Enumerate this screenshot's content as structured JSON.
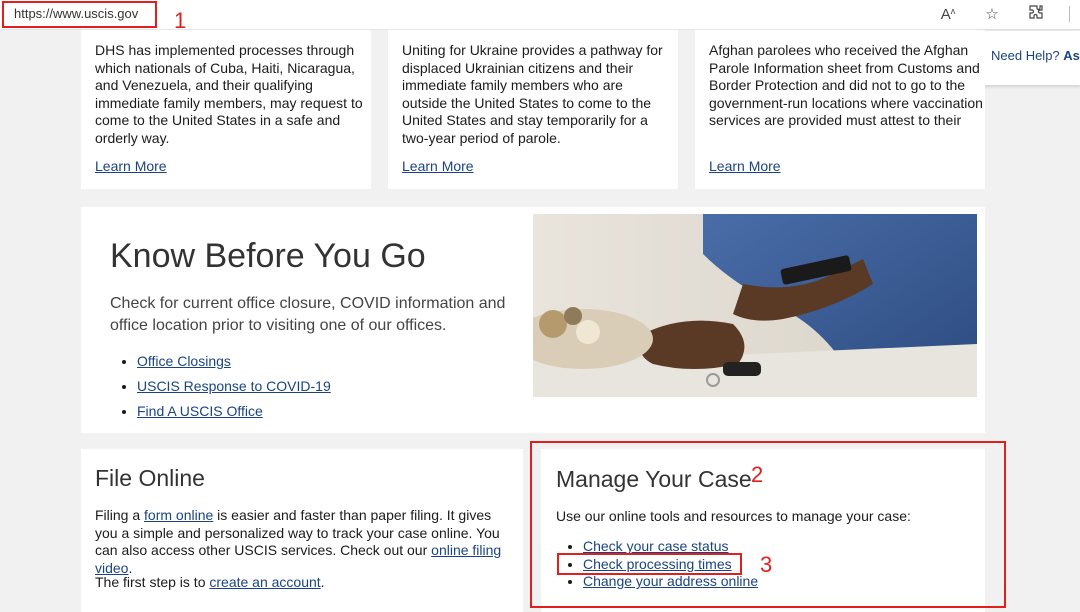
{
  "browser": {
    "url": "https://www.uscis.gov",
    "icons": [
      "read-aloud-icon",
      "add-favorite-icon",
      "extensions-icon"
    ]
  },
  "annotations": [
    "1",
    "2",
    "3"
  ],
  "need_help": {
    "text": "Need Help?",
    "ask": "Ask"
  },
  "cards": [
    {
      "text": "DHS has implemented processes through which nationals of Cuba, Haiti, Nicaragua, and Venezuela, and their qualifying immediate family members, may request to come to the United States in a safe and orderly way.",
      "link": "Learn More"
    },
    {
      "text": "Uniting for Ukraine provides a pathway for displaced Ukrainian citizens and their immediate family members who are outside the United States to come to the United States and stay temporarily for a two-year period of parole.",
      "link": "Learn More"
    },
    {
      "text": "Afghan parolees who received the Afghan Parole Information sheet from Customs and Border Protection and did not to go to the government-run locations where vaccination services are provided must attest to their",
      "link": "Learn More"
    }
  ],
  "know_before": {
    "title": "Know Before You Go",
    "desc": "Check for current office closure, COVID information and office location prior to visiting one of our offices.",
    "links": [
      "Office Closings",
      "USCIS Response to COVID-19",
      "Find A USCIS Office"
    ]
  },
  "file_online": {
    "title": "File Online",
    "p1_a": "Filing a ",
    "p1_link": "form online",
    "p1_b": " is easier and faster than paper filing. It gives you a simple and personalized way to track your case online. You can also access other USCIS services. Check out our ",
    "p1_link2": "online filing video",
    "p1_c": ".",
    "p2_a": "The first step is to ",
    "p2_link": "create an account",
    "p2_b": "."
  },
  "manage_case": {
    "title": "Manage Your Case",
    "intro": "Use our online tools and resources to manage your case:",
    "links": [
      "Check your case status",
      "Check processing times",
      "Change your address online"
    ]
  }
}
